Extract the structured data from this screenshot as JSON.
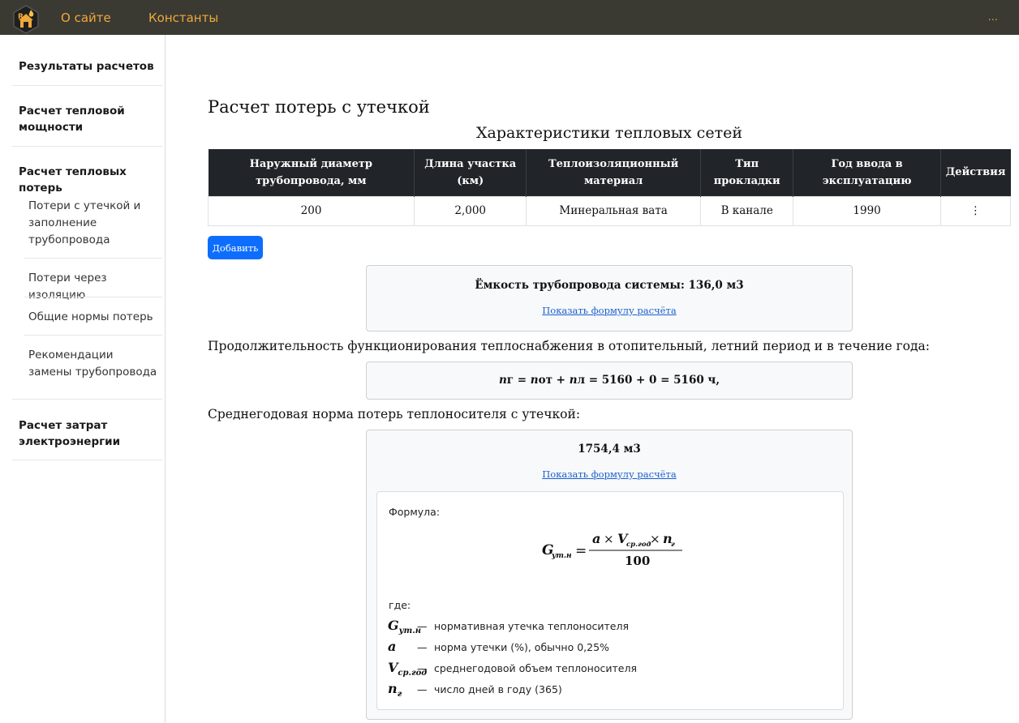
{
  "navbar": {
    "logo_icon": "house-flame-logo-icon",
    "links": [
      "О сайте",
      "Константы"
    ],
    "more": "..."
  },
  "sidebar": {
    "items": [
      {
        "label": "Результаты расчетов"
      },
      {
        "label": "Расчет тепловой мощности"
      },
      {
        "label": "Расчет тепловых потерь",
        "children": [
          "Потери с утечкой и заполнение трубопровода",
          "Потери через изоляцию",
          "Общие нормы потерь",
          "Рекомендации замены трубопровода"
        ]
      },
      {
        "label": "Расчет затрат электроэнергии"
      }
    ]
  },
  "main": {
    "title": "Расчет потерь с утечкой",
    "table_caption": "Характеристики тепловых сетей",
    "table": {
      "headers": [
        "Наружный диаметр трубопровода, мм",
        "Длина участка (км)",
        "Теплоизоляционный материал",
        "Тип прокладки",
        "Год ввода в эксплуатацию",
        "Действия"
      ],
      "rows": [
        [
          "200",
          "2,000",
          "Минеральная вата",
          "В канале",
          "1990",
          "⋮"
        ]
      ]
    },
    "add_button": "Добавить",
    "capacity_card": {
      "title": "Ёмкость трубопровода системы: 136,0 м3",
      "link": "Показать формулу расчёта"
    },
    "duration_text": "Продолжительность функционирования теплоснабжения в отопительный, летний период и в течение года:",
    "duration_formula": {
      "n1": "n",
      "s1": "г",
      "eq1": " = ",
      "n2": "n",
      "s2": "от",
      "plus": " + ",
      "n3": "n",
      "s3": "л",
      "rest": " = 5160 + 0 = 5160 ч,"
    },
    "norm_text": "Среднегодовая норма потерь теплоносителя с утечкой:",
    "norm_card": {
      "title": "1754,4 м3",
      "link": "Показать формулу расчёта",
      "formula_label": "Формула:",
      "formula": {
        "lhs": "G",
        "lhs_sub": "ут.н",
        "num_a": "a",
        "times": "×",
        "num_v": "V",
        "num_v_sub": "ср.год",
        "num_n": "n",
        "num_n_sub": "г",
        "den": "100"
      },
      "where_label": "где:",
      "legend": [
        {
          "sym": "G",
          "sub": "ут.н",
          "dash": "—",
          "desc": "нормативная утечка теплоносителя"
        },
        {
          "sym": "a",
          "sub": "",
          "dash": "—",
          "desc": "норма утечки (%), обычно 0,25%"
        },
        {
          "sym": "V",
          "sub": "ср.год",
          "dash": "—",
          "desc": "среднегодовой объем теплоносителя"
        },
        {
          "sym": "n",
          "sub": "г",
          "dash": "—",
          "desc": "число дней в году (365)"
        }
      ]
    }
  }
}
